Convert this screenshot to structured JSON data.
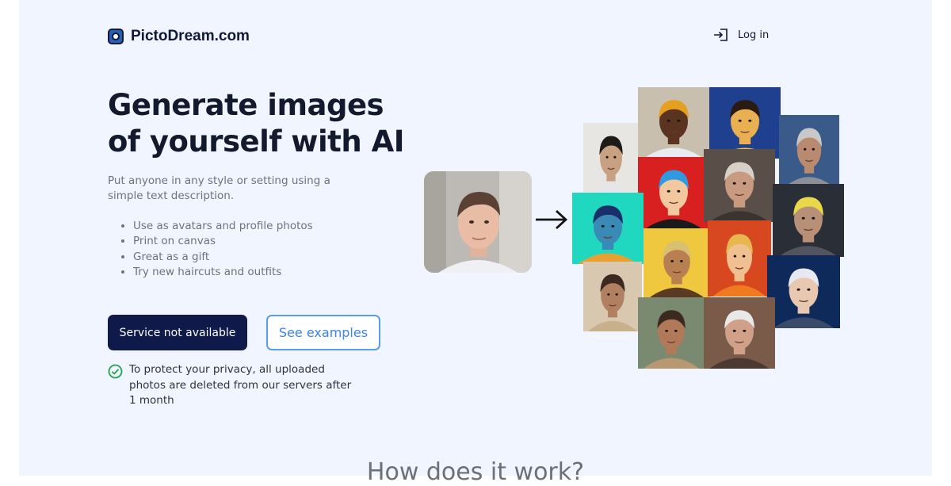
{
  "header": {
    "brand": "PictoDream.com",
    "login_label": "Log in"
  },
  "hero": {
    "title_line1": "Generate images",
    "title_line2": "of yourself with AI",
    "subtitle": "Put anyone in any style or setting using a simple text description.",
    "features": [
      "Use as avatars and profile photos",
      "Print on canvas",
      "Great as a gift",
      "Try new haircuts and outfits"
    ],
    "primary_button": "Service not available",
    "secondary_button": "See examples",
    "privacy_note": "To protect your privacy, all uploaded photos are deleted from our servers after 1 month"
  },
  "section": {
    "how_it_works_title": "How does it work?"
  },
  "icons": {
    "logo": "logo-icon",
    "login": "login-icon",
    "arrow": "arrow-right-icon",
    "privacy": "check-circle-icon"
  },
  "colors": {
    "page_background": "#f0f5ff",
    "primary_button": "#0f1a4a",
    "accent_blue": "#3b82f6",
    "check_green": "#22a34a",
    "heading": "#141a2e"
  }
}
